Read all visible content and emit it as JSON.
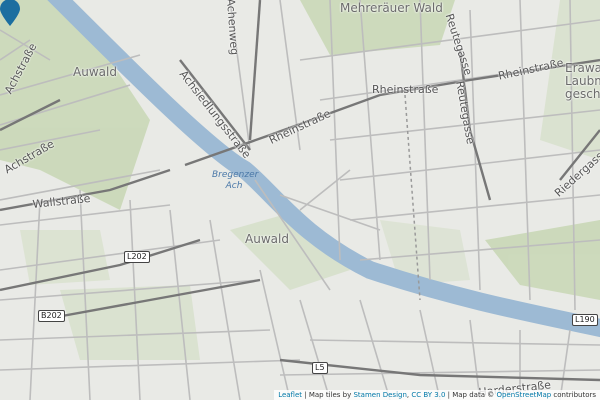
{
  "map": {
    "areas": [
      "Mehreräuer Wald",
      "Auwald",
      "Auwald",
      "Erawa Laubmis gesch"
    ],
    "streets": [
      "Achsiedlungsstraße",
      "Rheinstraße",
      "Rheinstraße",
      "Rheinstraße",
      "Reutegasse",
      "Reutegasse",
      "Wallstraße",
      "Achstraße",
      "Achstraße",
      "Riedergasse",
      "Harderstraße",
      "Achenweg"
    ],
    "water": [
      "Bregenzer Ach"
    ],
    "shields": [
      "L202",
      "B202",
      "L5",
      "L190"
    ],
    "marker": {
      "icon": "map-pin-icon",
      "color": "#1c6ea0"
    },
    "attribution": {
      "leaflet": "Leaflet",
      "sep1": " | Map tiles by ",
      "stamen": "Stamen Design",
      "cc": "CC BY 3.0",
      "sep2": " | Map data © ",
      "osm": "OpenStreetMap",
      "contributors": " contributors"
    }
  }
}
